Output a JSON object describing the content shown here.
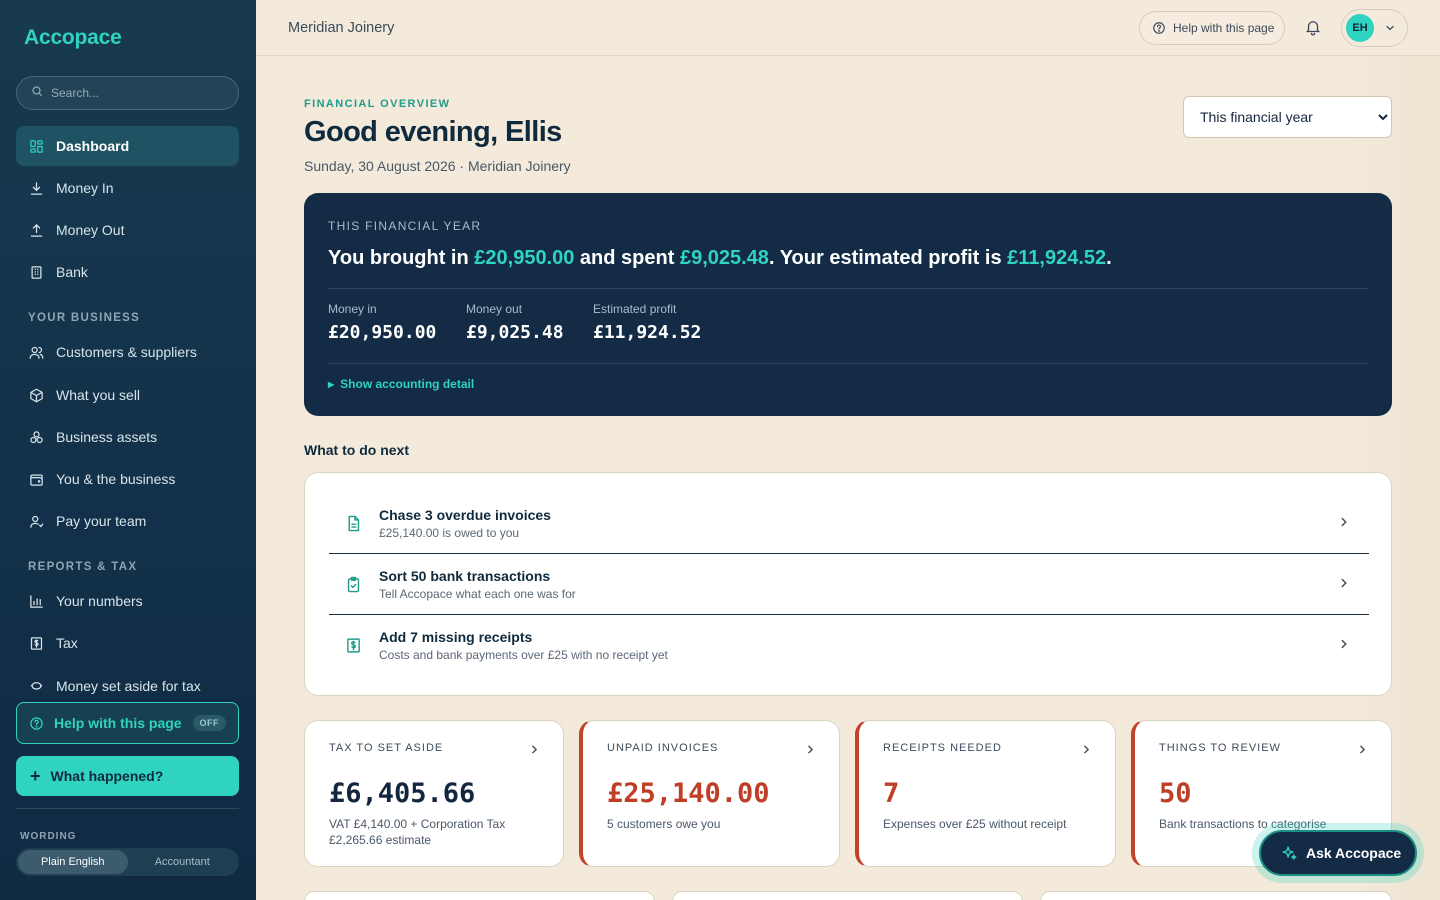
{
  "app": {
    "name": "Accopace"
  },
  "sidebar": {
    "search_placeholder": "Search...",
    "main_items": [
      {
        "label": "Dashboard",
        "icon": "dashboard-icon",
        "active": true
      },
      {
        "label": "Money In",
        "icon": "download-icon"
      },
      {
        "label": "Money Out",
        "icon": "upload-icon"
      },
      {
        "label": "Bank",
        "icon": "bank-icon"
      }
    ],
    "section_business": "YOUR BUSINESS",
    "business_items": [
      {
        "label": "Customers & suppliers",
        "icon": "users-icon"
      },
      {
        "label": "What you sell",
        "icon": "box-icon"
      },
      {
        "label": "Business assets",
        "icon": "assets-icon"
      },
      {
        "label": "You & the business",
        "icon": "wallet-icon"
      },
      {
        "label": "Pay your team",
        "icon": "user-icon"
      }
    ],
    "section_reports": "REPORTS & TAX",
    "reports_items": [
      {
        "label": "Your numbers",
        "icon": "bar-chart-icon"
      },
      {
        "label": "Tax",
        "icon": "tax-icon"
      },
      {
        "label": "Money set aside for tax",
        "icon": "piggy-bank-icon"
      }
    ],
    "help_toggle": {
      "label": "Help with this page",
      "state": "OFF"
    },
    "what_happened": "What happened?",
    "wording": {
      "label": "WORDING",
      "options": [
        "Plain English",
        "Accountant"
      ],
      "selected": "Plain English"
    }
  },
  "topbar": {
    "business_name": "Meridian Joinery",
    "help_label": "Help with this page",
    "user_initials": "EH"
  },
  "header": {
    "overline": "FINANCIAL OVERVIEW",
    "greeting": "Good evening, Ellis",
    "subline": "Sunday, 30 August 2026 · Meridian Joinery",
    "period_options": [
      "This financial year"
    ],
    "period_selected": "This financial year"
  },
  "summary": {
    "overline": "THIS FINANCIAL YEAR",
    "headline": {
      "p1": "You brought in ",
      "money_in": "£20,950.00",
      "p2": " and spent ",
      "money_out": "£9,025.48",
      "p3": ". Your estimated profit is ",
      "profit": "£11,924.52",
      "p4": "."
    },
    "stats": [
      {
        "label": "Money in",
        "value": "£20,950.00"
      },
      {
        "label": "Money out",
        "value": "£9,025.48"
      },
      {
        "label": "Estimated profit",
        "value": "£11,924.52"
      }
    ],
    "detail_link": "Show accounting detail"
  },
  "todo": {
    "title": "What to do next",
    "items": [
      {
        "title": "Chase 3 overdue invoices",
        "subtitle": "£25,140.00 is owed to you",
        "icon": "document-icon"
      },
      {
        "title": "Sort 50 bank transactions",
        "subtitle": "Tell Accopace what each one was for",
        "icon": "clipboard-check-icon"
      },
      {
        "title": "Add 7 missing receipts",
        "subtitle": "Costs and bank payments over £25 with no receipt yet",
        "icon": "receipt-icon"
      }
    ]
  },
  "kpis": [
    {
      "label": "TAX TO SET ASIDE",
      "value": "£6,405.66",
      "sub": "VAT £4,140.00 + Corporation Tax £2,265.66 estimate",
      "alert": false
    },
    {
      "label": "UNPAID INVOICES",
      "value": "£25,140.00",
      "sub": "5 customers owe you",
      "alert": true
    },
    {
      "label": "RECEIPTS NEEDED",
      "value": "7",
      "sub": "Expenses over £25 without receipt",
      "alert": true
    },
    {
      "label": "THINGS TO REVIEW",
      "value": "50",
      "sub": "Bank transactions to categorise",
      "alert": true
    }
  ],
  "ask_button": "Ask Accopace",
  "colors": {
    "accent": "#2fd3c0",
    "navy": "#132b45",
    "alert": "#bf3f26",
    "background": "#f3eadc"
  }
}
